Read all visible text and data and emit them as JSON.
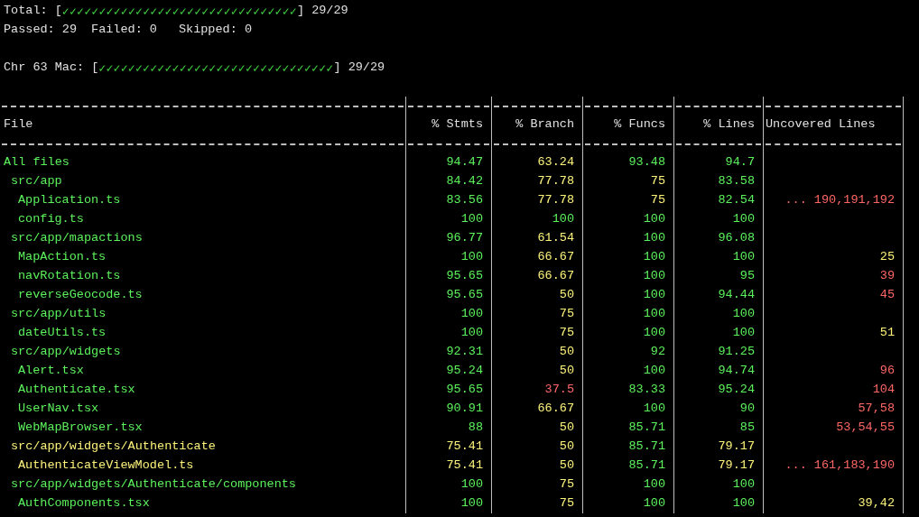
{
  "summary": {
    "total": {
      "label": "Total:",
      "open": "[",
      "ticks": "✓✓✓✓✓✓✓✓✓✓✓✓✓✓✓✓✓✓✓✓✓✓✓✓✓✓✓✓✓✓✓✓",
      "close": "]",
      "count": "29/29"
    },
    "counts": [
      {
        "label": "Passed:",
        "value": "29"
      },
      {
        "label": "Failed:",
        "value": "0"
      },
      {
        "label": "Skipped:",
        "value": "0"
      }
    ],
    "browser": {
      "label": "Chr 63 Mac:",
      "open": "[",
      "ticks": "✓✓✓✓✓✓✓✓✓✓✓✓✓✓✓✓✓✓✓✓✓✓✓✓✓✓✓✓✓✓✓✓",
      "close": "]",
      "count": "29/29"
    }
  },
  "table": {
    "columns": [
      "File",
      "% Stmts",
      "% Branch",
      "% Funcs",
      "% Lines",
      "Uncovered Lines"
    ],
    "rows": [
      {
        "name": "All files",
        "stmts": {
          "value": "94.47",
          "color": "#5cf25c"
        },
        "branch": {
          "value": "63.24",
          "color": "#fcf27a"
        },
        "funcs": {
          "value": "93.48",
          "color": "#5cf25c"
        },
        "lines": {
          "value": "94.7",
          "color": "#5cf25c"
        },
        "children": [
          {
            "name": "src/app",
            "stmts": {
              "value": "84.42",
              "color": "#5cf25c"
            },
            "branch": {
              "value": "77.78",
              "color": "#fcf27a"
            },
            "funcs": {
              "value": "75",
              "color": "#fcf27a"
            },
            "lines": {
              "value": "83.58",
              "color": "#5cf25c"
            },
            "children": [
              {
                "name": "Application.ts",
                "stmts": {
                  "value": "83.56",
                  "color": "#5cf25c"
                },
                "branch": {
                  "value": "77.78",
                  "color": "#fcf27a"
                },
                "funcs": {
                  "value": "75",
                  "color": "#fcf27a"
                },
                "lines": {
                  "value": "82.54",
                  "color": "#5cf25c"
                },
                "uncovered": {
                  "value": "... 190,191,192",
                  "color": "#ff6666"
                }
              },
              {
                "name": "config.ts",
                "stmts": {
                  "value": "100",
                  "color": "#5cf25c"
                },
                "branch": {
                  "value": "100",
                  "color": "#5cf25c"
                },
                "funcs": {
                  "value": "100",
                  "color": "#5cf25c"
                },
                "lines": {
                  "value": "100",
                  "color": "#5cf25c"
                }
              }
            ]
          },
          {
            "name": "src/app/mapactions",
            "stmts": {
              "value": "96.77",
              "color": "#5cf25c"
            },
            "branch": {
              "value": "61.54",
              "color": "#fcf27a"
            },
            "funcs": {
              "value": "100",
              "color": "#5cf25c"
            },
            "lines": {
              "value": "96.08",
              "color": "#5cf25c"
            },
            "children": [
              {
                "name": "MapAction.ts",
                "stmts": {
                  "value": "100",
                  "color": "#5cf25c"
                },
                "branch": {
                  "value": "66.67",
                  "color": "#fcf27a"
                },
                "funcs": {
                  "value": "100",
                  "color": "#5cf25c"
                },
                "lines": {
                  "value": "100",
                  "color": "#5cf25c"
                },
                "uncovered": {
                  "value": "25",
                  "color": "#fcf27a"
                }
              },
              {
                "name": "navRotation.ts",
                "stmts": {
                  "value": "95.65",
                  "color": "#5cf25c"
                },
                "branch": {
                  "value": "66.67",
                  "color": "#fcf27a"
                },
                "funcs": {
                  "value": "100",
                  "color": "#5cf25c"
                },
                "lines": {
                  "value": "95",
                  "color": "#5cf25c"
                },
                "uncovered": {
                  "value": "39",
                  "color": "#ff6666"
                }
              },
              {
                "name": "reverseGeocode.ts",
                "stmts": {
                  "value": "95.65",
                  "color": "#5cf25c"
                },
                "branch": {
                  "value": "50",
                  "color": "#fcf27a"
                },
                "funcs": {
                  "value": "100",
                  "color": "#5cf25c"
                },
                "lines": {
                  "value": "94.44",
                  "color": "#5cf25c"
                },
                "uncovered": {
                  "value": "45",
                  "color": "#ff6666"
                }
              }
            ]
          },
          {
            "name": "src/app/utils",
            "stmts": {
              "value": "100",
              "color": "#5cf25c"
            },
            "branch": {
              "value": "75",
              "color": "#fcf27a"
            },
            "funcs": {
              "value": "100",
              "color": "#5cf25c"
            },
            "lines": {
              "value": "100",
              "color": "#5cf25c"
            },
            "children": [
              {
                "name": "dateUtils.ts",
                "stmts": {
                  "value": "100",
                  "color": "#5cf25c"
                },
                "branch": {
                  "value": "75",
                  "color": "#fcf27a"
                },
                "funcs": {
                  "value": "100",
                  "color": "#5cf25c"
                },
                "lines": {
                  "value": "100",
                  "color": "#5cf25c"
                },
                "uncovered": {
                  "value": "51",
                  "color": "#fcf27a"
                }
              }
            ]
          },
          {
            "name": "src/app/widgets",
            "stmts": {
              "value": "92.31",
              "color": "#5cf25c"
            },
            "branch": {
              "value": "50",
              "color": "#fcf27a"
            },
            "funcs": {
              "value": "92",
              "color": "#5cf25c"
            },
            "lines": {
              "value": "91.25",
              "color": "#5cf25c"
            },
            "children": [
              {
                "name": "Alert.tsx",
                "stmts": {
                  "value": "95.24",
                  "color": "#5cf25c"
                },
                "branch": {
                  "value": "50",
                  "color": "#fcf27a"
                },
                "funcs": {
                  "value": "100",
                  "color": "#5cf25c"
                },
                "lines": {
                  "value": "94.74",
                  "color": "#5cf25c"
                },
                "uncovered": {
                  "value": "96",
                  "color": "#ff6666"
                }
              },
              {
                "name": "Authenticate.tsx",
                "stmts": {
                  "value": "95.65",
                  "color": "#5cf25c"
                },
                "branch": {
                  "value": "37.5",
                  "color": "#ff6666"
                },
                "funcs": {
                  "value": "83.33",
                  "color": "#5cf25c"
                },
                "lines": {
                  "value": "95.24",
                  "color": "#5cf25c"
                },
                "uncovered": {
                  "value": "104",
                  "color": "#ff6666"
                }
              },
              {
                "name": "UserNav.tsx",
                "stmts": {
                  "value": "90.91",
                  "color": "#5cf25c"
                },
                "branch": {
                  "value": "66.67",
                  "color": "#fcf27a"
                },
                "funcs": {
                  "value": "100",
                  "color": "#5cf25c"
                },
                "lines": {
                  "value": "90",
                  "color": "#5cf25c"
                },
                "uncovered": {
                  "value": "57,58",
                  "color": "#ff6666"
                }
              },
              {
                "name": "WebMapBrowser.tsx",
                "stmts": {
                  "value": "88",
                  "color": "#5cf25c"
                },
                "branch": {
                  "value": "50",
                  "color": "#fcf27a"
                },
                "funcs": {
                  "value": "85.71",
                  "color": "#5cf25c"
                },
                "lines": {
                  "value": "85",
                  "color": "#5cf25c"
                },
                "uncovered": {
                  "value": "53,54,55",
                  "color": "#ff6666"
                }
              }
            ]
          },
          {
            "name": "src/app/widgets/Authenticate",
            "stmts": {
              "value": "75.41",
              "color": "#fcf27a"
            },
            "branch": {
              "value": "50",
              "color": "#fcf27a"
            },
            "funcs": {
              "value": "85.71",
              "color": "#5cf25c"
            },
            "lines": {
              "value": "79.17",
              "color": "#fcf27a"
            },
            "children": [
              {
                "name": "AuthenticateViewModel.ts",
                "stmts": {
                  "value": "75.41",
                  "color": "#fcf27a"
                },
                "branch": {
                  "value": "50",
                  "color": "#fcf27a"
                },
                "funcs": {
                  "value": "85.71",
                  "color": "#5cf25c"
                },
                "lines": {
                  "value": "79.17",
                  "color": "#fcf27a"
                },
                "uncovered": {
                  "value": "... 161,183,190",
                  "color": "#ff6666"
                }
              }
            ]
          },
          {
            "name": "src/app/widgets/Authenticate/components",
            "stmts": {
              "value": "100",
              "color": "#5cf25c"
            },
            "branch": {
              "value": "75",
              "color": "#fcf27a"
            },
            "funcs": {
              "value": "100",
              "color": "#5cf25c"
            },
            "lines": {
              "value": "100",
              "color": "#5cf25c"
            },
            "children": [
              {
                "name": "AuthComponents.tsx",
                "stmts": {
                  "value": "100",
                  "color": "#5cf25c"
                },
                "branch": {
                  "value": "75",
                  "color": "#fcf27a"
                },
                "funcs": {
                  "value": "100",
                  "color": "#5cf25c"
                },
                "lines": {
                  "value": "100",
                  "color": "#5cf25c"
                },
                "uncovered": {
                  "value": "39,42",
                  "color": "#fcf27a"
                }
              }
            ]
          }
        ]
      }
    ]
  }
}
